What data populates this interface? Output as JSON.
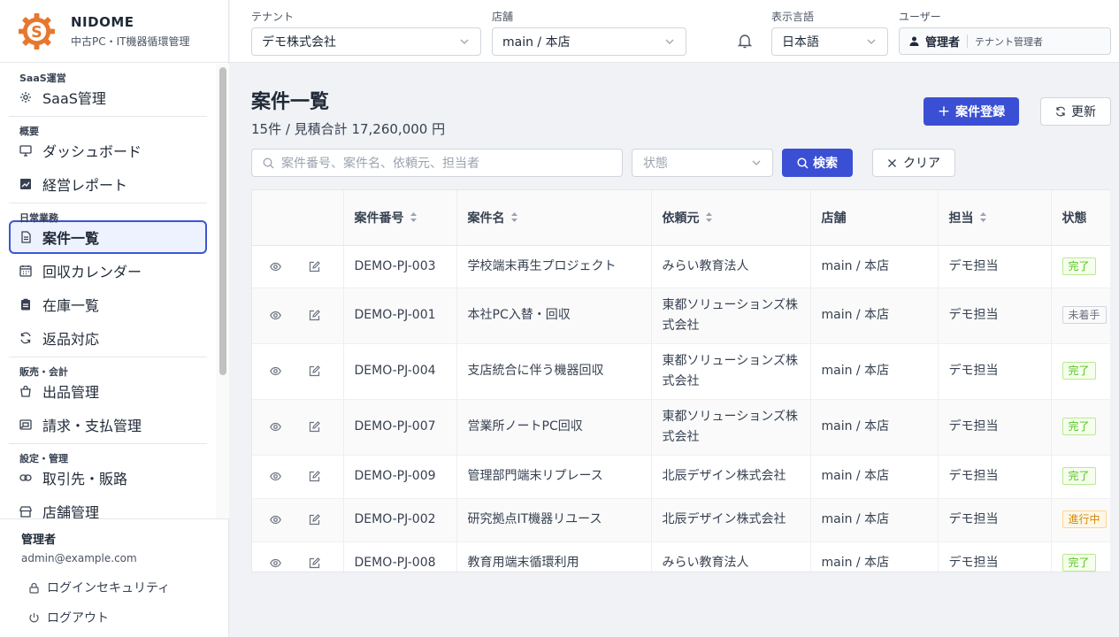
{
  "brand": {
    "name": "NIDOME",
    "subtitle": "中古PC・IT機器循環管理",
    "logo_letter": "S",
    "logo_color": "#e8772e"
  },
  "sidebar": {
    "sections": [
      {
        "title": "SaaS運営",
        "items": [
          {
            "label": "SaaS管理",
            "icon": "gear-icon"
          }
        ]
      },
      {
        "title": "概要",
        "items": [
          {
            "label": "ダッシュボード",
            "icon": "monitor-icon"
          },
          {
            "label": "経営レポート",
            "icon": "chart-icon"
          }
        ]
      },
      {
        "title": "日常業務",
        "items": [
          {
            "label": "案件一覧",
            "icon": "document-icon",
            "active": true
          },
          {
            "label": "回収カレンダー",
            "icon": "calendar-icon"
          },
          {
            "label": "在庫一覧",
            "icon": "clipboard-icon"
          },
          {
            "label": "返品対応",
            "icon": "refresh-icon"
          }
        ]
      },
      {
        "title": "販売・会計",
        "items": [
          {
            "label": "出品管理",
            "icon": "shop-icon"
          },
          {
            "label": "請求・支払管理",
            "icon": "invoice-icon"
          }
        ]
      },
      {
        "title": "設定・管理",
        "items": [
          {
            "label": "取引先・販路",
            "icon": "link-icon"
          },
          {
            "label": "店舗管理",
            "icon": "store-icon"
          }
        ]
      }
    ],
    "footer": {
      "user_name": "管理者",
      "email": "admin@example.com",
      "security": "ログインセキュリティ",
      "logout": "ログアウト"
    }
  },
  "header": {
    "tenant_label": "テナント",
    "tenant_value": "デモ株式会社",
    "store_label": "店舗",
    "store_value": "main / 本店",
    "lang_label": "表示言語",
    "lang_value": "日本語",
    "user_label": "ユーザー",
    "user_role": "管理者",
    "user_sub": "テナント管理者"
  },
  "page": {
    "title": "案件一覧",
    "summary": "15件 / 見積合計 17,260,000 円",
    "register_button": "案件登録",
    "refresh_button": "更新",
    "search_placeholder": "案件番号、案件名、依頼元、担当者",
    "status_placeholder": "状態",
    "search_button": "検索",
    "clear_button": "クリア"
  },
  "table": {
    "columns": [
      "案件番号",
      "案件名",
      "依頼元",
      "店舗",
      "担当",
      "状態"
    ],
    "rows": [
      {
        "id": "DEMO-PJ-003",
        "name": "学校端末再生プロジェクト",
        "client": "みらい教育法人",
        "store": "main / 本店",
        "owner": "デモ担当",
        "status": "完了",
        "kind": "done"
      },
      {
        "id": "DEMO-PJ-001",
        "name": "本社PC入替・回収",
        "client": "東都ソリューションズ株式会社",
        "store": "main / 本店",
        "owner": "デモ担当",
        "status": "未着手",
        "kind": "todo"
      },
      {
        "id": "DEMO-PJ-004",
        "name": "支店統合に伴う機器回収",
        "client": "東都ソリューションズ株式会社",
        "store": "main / 本店",
        "owner": "デモ担当",
        "status": "完了",
        "kind": "done"
      },
      {
        "id": "DEMO-PJ-007",
        "name": "営業所ノートPC回収",
        "client": "東都ソリューションズ株式会社",
        "store": "main / 本店",
        "owner": "デモ担当",
        "status": "完了",
        "kind": "done"
      },
      {
        "id": "DEMO-PJ-009",
        "name": "管理部門端末リプレース",
        "client": "北辰デザイン株式会社",
        "store": "main / 本店",
        "owner": "デモ担当",
        "status": "完了",
        "kind": "done"
      },
      {
        "id": "DEMO-PJ-002",
        "name": "研究拠点IT機器リユース",
        "client": "北辰デザイン株式会社",
        "store": "main / 本店",
        "owner": "デモ担当",
        "status": "進行中",
        "kind": "prog"
      },
      {
        "id": "DEMO-PJ-008",
        "name": "教育用端末循環利用",
        "client": "みらい教育法人",
        "store": "main / 本店",
        "owner": "デモ担当",
        "status": "完了",
        "kind": "done"
      }
    ]
  },
  "colors": {
    "primary": "#3b4fd4",
    "active_border": "#3b56d6",
    "done": "#52c41a",
    "progress": "#d48806"
  }
}
